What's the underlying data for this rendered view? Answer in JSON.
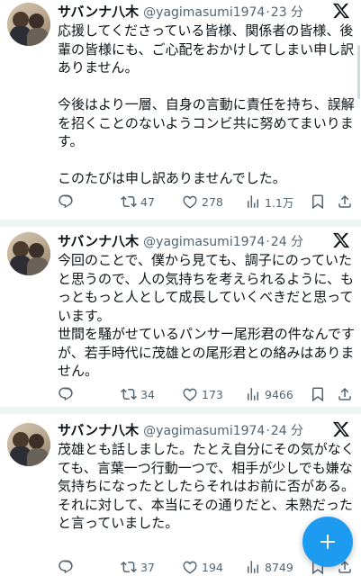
{
  "tweets": [
    {
      "name": "サバンナ八木",
      "handle": "@yagimasumi1974",
      "dot": "·",
      "time": "23 分",
      "text": "応援してくださっている皆様、関係者の皆様、後輩の皆様にも、ご心配をおかけしてしまい申し訳ありません。\n\n今後はより一層、自身の言動に責任を持ち、誤解を招くことのないようコンビ共に努めてまいります。\n\nこのたびは申し訳ありませんでした。",
      "retweets": "47",
      "likes": "278",
      "views": "1.1万"
    },
    {
      "name": "サバンナ八木",
      "handle": "@yagimasumi1974",
      "dot": "·",
      "time": "24 分",
      "text": "今回のことで、僕から見ても、調子にのっていたと思うので、人の気持ちを考えられるように、もっともっと人として成長していくべきだと思っています。\n世間を騒がせているパンサー尾形君の件なんですが、若手時代に茂雄との尾形君との絡みはありません。",
      "retweets": "34",
      "likes": "173",
      "views": "9466"
    },
    {
      "name": "サバンナ八木",
      "handle": "@yagimasumi1974",
      "dot": "·",
      "time": "24 分",
      "text": "茂雄とも話しました。たとえ自分にその気がなくても、言葉一つ行動一つで、相手が少しでも嫌な気持ちになったとしたらそれはお前に否がある。\nそれに対して、本当にその通りだと、未熟だったと言っていました。",
      "retweets": "37",
      "likes": "194",
      "views": "8749"
    }
  ],
  "icons": {
    "reply": "reply-icon",
    "retweet": "retweet-icon",
    "like": "heart-icon",
    "views": "views-icon",
    "bookmark": "bookmark-icon",
    "share": "share-icon",
    "x": "x-logo-icon",
    "compose": "plus-icon"
  },
  "colors": {
    "accent": "#1d9bf0",
    "muted": "#536471",
    "text": "#0f1419",
    "separator": "#eff3f4"
  }
}
